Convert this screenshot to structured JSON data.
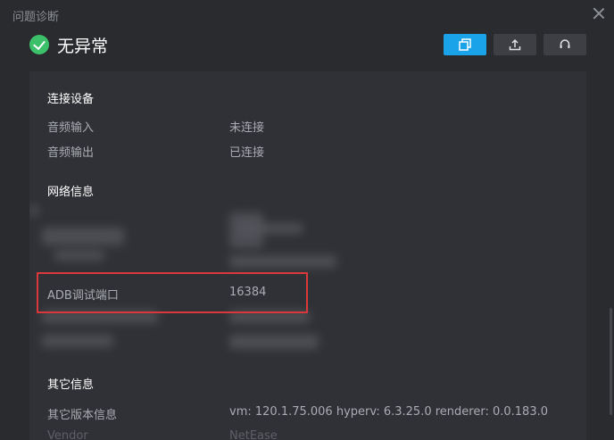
{
  "window": {
    "title": "问题诊断"
  },
  "status": {
    "text": "无异常"
  },
  "toolbar": {
    "copy_icon": "copy-icon",
    "upload_icon": "upload-icon",
    "support_icon": "headset-icon"
  },
  "sections": {
    "devices": {
      "title": "连接设备",
      "rows": [
        {
          "label": "音频输入",
          "value": "未连接"
        },
        {
          "label": "音频输出",
          "value": "已连接"
        }
      ]
    },
    "network": {
      "title": "网络信息",
      "adb": {
        "label": "ADB调试端口",
        "value": "16384"
      }
    },
    "other": {
      "title": "其它信息",
      "rows": [
        {
          "label": "其它版本信息",
          "value": "vm: 120.1.75.006 hyperv: 6.3.25.0 renderer: 0.0.183.0"
        },
        {
          "label": "Vendor",
          "value": "NetEase"
        }
      ]
    }
  },
  "colors": {
    "accent": "#1aa3e8",
    "success": "#3cc06a",
    "highlight": "#d9393a"
  }
}
